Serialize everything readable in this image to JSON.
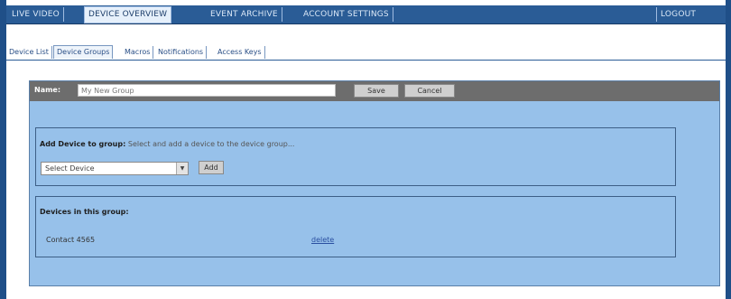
{
  "top_nav": {
    "items": [
      "LIVE VIDEO",
      "DEVICE OVERVIEW",
      "EVENT ARCHIVE",
      "ACCOUNT SETTINGS"
    ],
    "logout": "LOGOUT"
  },
  "sub_nav": {
    "tabs": [
      "Device List",
      "Device Groups",
      "Macros",
      "Notifications",
      "Access Keys"
    ]
  },
  "name_bar": {
    "label": "Name:",
    "name_value": "My New Group",
    "save_label": "Save",
    "cancel_label": "Cancel"
  },
  "add_device": {
    "title": "Add Device to group:",
    "hint": "Select and add a device to the device group...",
    "select_value": "Select Device",
    "add_label": "Add"
  },
  "devices_in_group": {
    "title": "Devices in this group:",
    "rows": [
      {
        "name": "Contact 4565",
        "action": "delete"
      }
    ]
  },
  "colors": {
    "nav_bg": "#2a5c96",
    "panel_bg": "#97c1ea",
    "namebar_bg": "#6d6d6d"
  }
}
